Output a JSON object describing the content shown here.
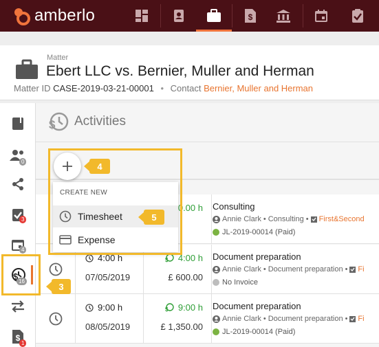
{
  "app": {
    "name": "amberlo"
  },
  "nav": {
    "active": "matters"
  },
  "matter": {
    "kind_label": "Matter",
    "title": "Ebert LLC vs. Bernier, Muller and Herman",
    "id_label": "Matter ID",
    "id_value": "CASE-2019-03-21-00001",
    "contact_label": "Contact",
    "contact_value": "Bernier, Muller and Herman"
  },
  "sidebar": {
    "people_badge": "0",
    "tasks_badge": "3",
    "calendar_badge": "4",
    "activities_badge": "16",
    "billing_badge": "1"
  },
  "activities": {
    "title": "Activities"
  },
  "menu": {
    "header": "CREATE NEW",
    "items": [
      {
        "label": "Timesheet"
      },
      {
        "label": "Expense"
      }
    ]
  },
  "callouts": {
    "c3": "3",
    "c4": "4",
    "c5": "5"
  },
  "rows": [
    {
      "bill_hours": "0.00 h",
      "description": "Consulting",
      "user": "Annie Clark",
      "activity_type": "Consulting",
      "phase": "First&Second",
      "invoice": "JL-2019-00014 (Paid)"
    },
    {
      "hours": "4:00 h",
      "date": "07/05/2019",
      "bill_hours": "4:00 h",
      "amount": "£ 600.00",
      "description": "Document preparation",
      "user": "Annie Clark",
      "activity_type": "Document preparation",
      "phase": "Fi",
      "invoice": "No Invoice"
    },
    {
      "hours": "9:00 h",
      "date": "08/05/2019",
      "bill_hours": "9:00 h",
      "amount": "£ 1,350.00",
      "description": "Document preparation",
      "user": "Annie Clark",
      "activity_type": "Document preparation",
      "phase": "Fi",
      "invoice": "JL-2019-00014 (Paid)"
    }
  ],
  "colors": {
    "brand": "#4a1016",
    "accent": "#e8742f",
    "highlight": "#f2b92b",
    "billable": "#2e9e36"
  }
}
